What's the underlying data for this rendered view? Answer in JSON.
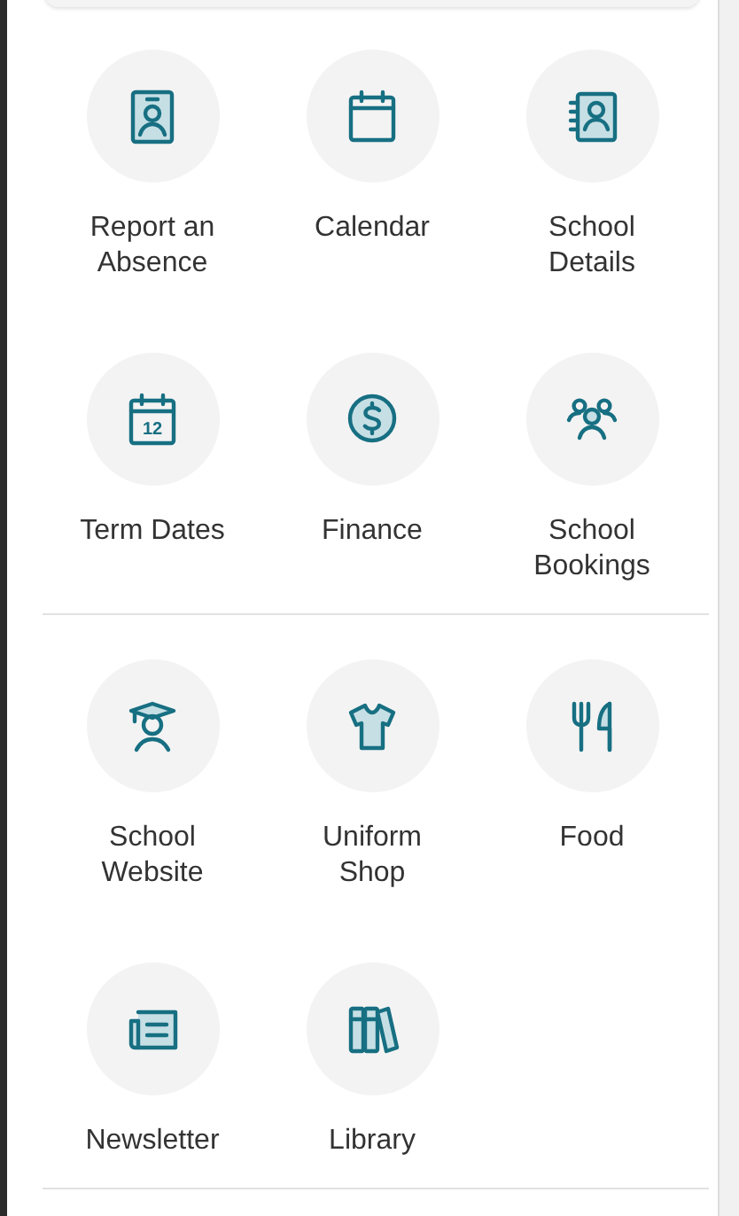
{
  "sections": [
    {
      "items": [
        {
          "label": "Report an Absence"
        },
        {
          "label": "Calendar"
        },
        {
          "label": "School Details"
        },
        {
          "label": "Term Dates",
          "icon_label": "12"
        },
        {
          "label": "Finance"
        },
        {
          "label": "School Bookings"
        }
      ]
    },
    {
      "items": [
        {
          "label": "School Website"
        },
        {
          "label": "Uniform Shop"
        },
        {
          "label": "Food"
        },
        {
          "label": "Newsletter"
        },
        {
          "label": "Library"
        }
      ]
    }
  ]
}
